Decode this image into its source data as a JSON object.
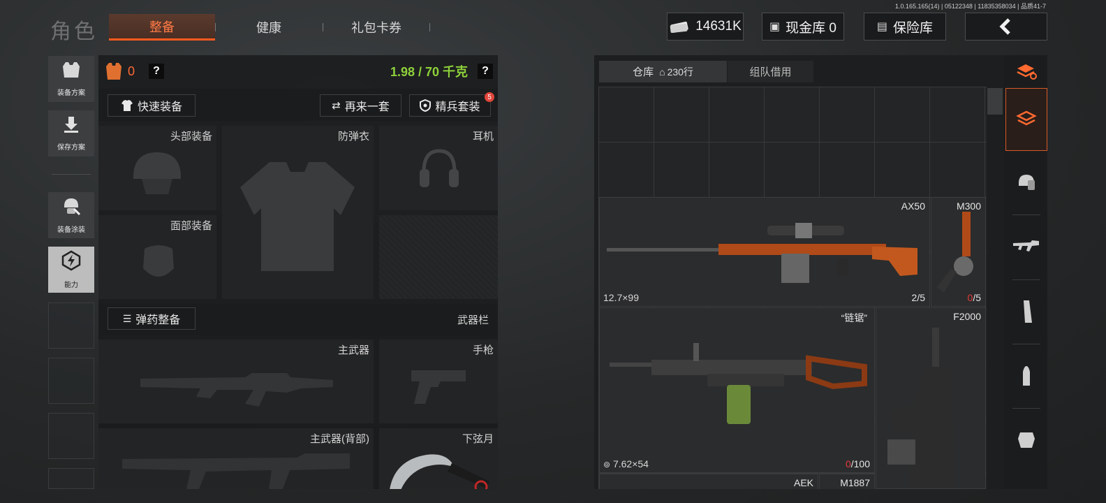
{
  "build_info": "1.0.165.165(14) | 05122348 | 11835358034 | 品质41-7",
  "app_title": "角色",
  "tabs": [
    {
      "label": "整备",
      "active": true
    },
    {
      "label": "健康",
      "active": false
    },
    {
      "label": "礼包卡券",
      "active": false
    }
  ],
  "currency": {
    "icon": "cash-icon",
    "value": "14631K"
  },
  "cash_vault": {
    "label": "现金库 0"
  },
  "safe_vault": {
    "label": "保险库"
  },
  "back_icon": "back-arrow-icon",
  "sidebar": [
    {
      "label": "装备方案",
      "icon": "vest-icon"
    },
    {
      "label": "保存方案",
      "icon": "download-icon"
    },
    {
      "label": "装备涂装",
      "icon": "helmet-paint-icon"
    },
    {
      "label": "能力",
      "icon": "ability-icon"
    }
  ],
  "loadout": {
    "armor_count": "0",
    "weight": "1.98 / 70 千克",
    "quick_equip": "快速装备",
    "again": "再来一套",
    "elite_kit": "精兵套装",
    "elite_badge": "5",
    "ammo_equip": "弹药整备",
    "weapon_bar": "武器栏",
    "slots": {
      "head": "头部装备",
      "vest": "防弹衣",
      "earphone": "耳机",
      "face": "面部装备",
      "primary": "主武器",
      "pistol": "手枪",
      "primary_back": "主武器(背部)",
      "melee": "下弦月"
    }
  },
  "warehouse": {
    "tab_label": "仓库",
    "rows": "230行",
    "team_borrow": "组队借用",
    "items": [
      {
        "name": "AX50",
        "caliber": "12.7×99",
        "count": "2/5"
      },
      {
        "name": "M300",
        "count_red": "0",
        "count_rest": "/5"
      },
      {
        "name": "“链锯”",
        "caliber": "7.62×54",
        "count_red": "0",
        "count_rest": "/100"
      },
      {
        "name": "F2000"
      },
      {
        "name": "AEK"
      },
      {
        "name": "M1887"
      }
    ]
  },
  "categories": [
    "all-items-icon",
    "backpack-icon",
    "helmet-icon",
    "rifle-icon",
    "magazine-icon",
    "ammo-icon",
    "armor-plate-icon"
  ],
  "colors": {
    "accent": "#ff5a1f",
    "weight": "#8ed13a",
    "red": "#e43b3b"
  }
}
